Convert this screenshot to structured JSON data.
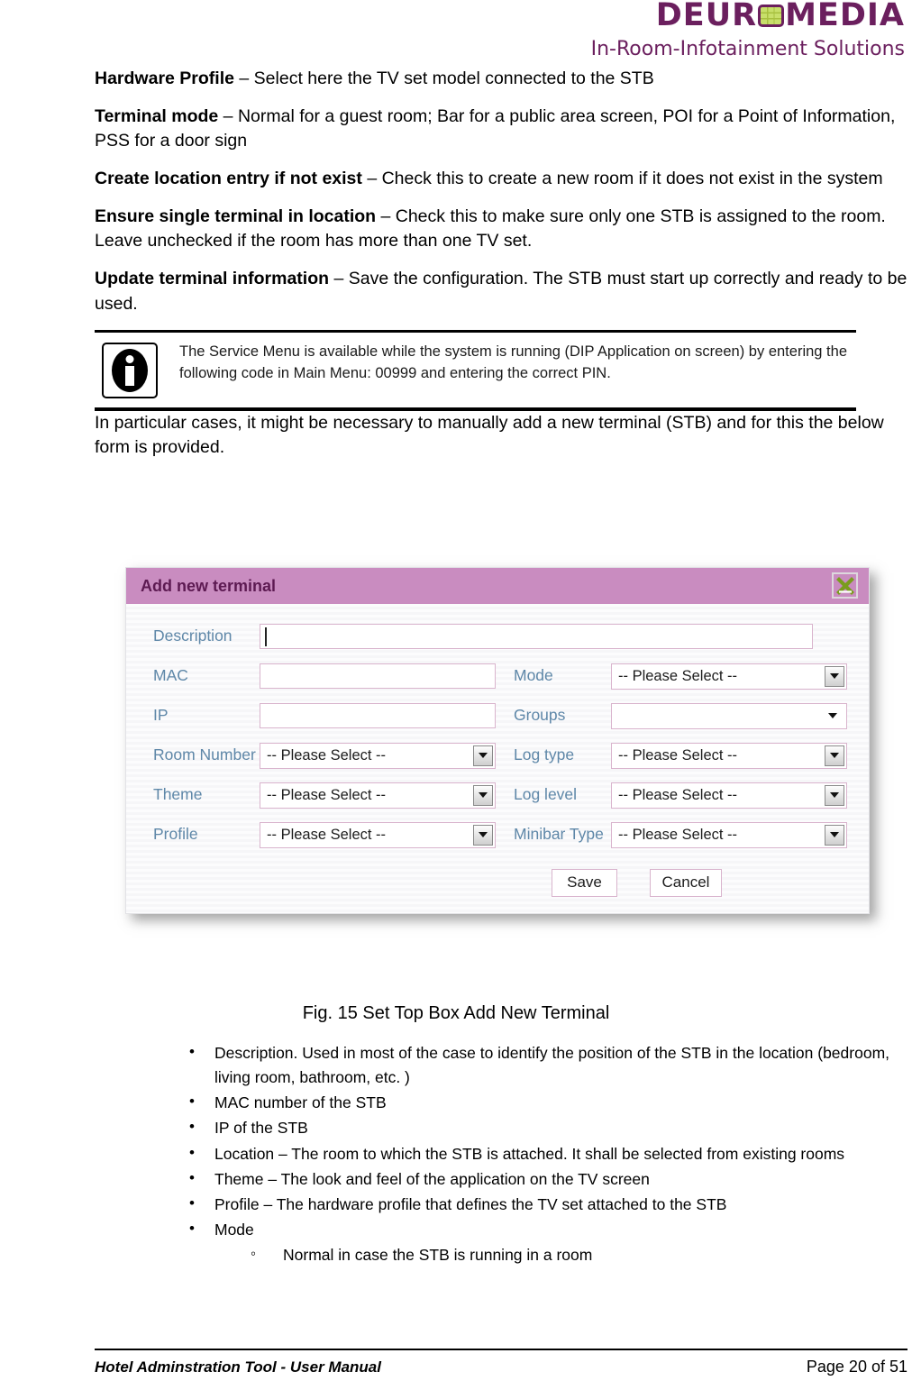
{
  "header": {
    "logo_text_before": "DEUR",
    "logo_icon": "tv-grid-icon",
    "logo_text_after": "MEDIA",
    "logo_tagline": "In-Room-Infotainment Solutions",
    "brand_color": "#6b1f5e",
    "accent_color": "#c8df6a"
  },
  "paragraphs": [
    {
      "term": "Hardware Profile",
      "rest": " – Select here the TV set model connected to the STB"
    },
    {
      "term": "Terminal mode",
      "rest": " – Normal for a guest room; Bar for a public area screen, POI for a Point of Information, PSS for a door sign"
    },
    {
      "term": "Create location entry if not exist",
      "rest": " – Check this to create a new room if it does not exist in the system"
    },
    {
      "term": "Ensure single terminal in location",
      "rest": " – Check this to make sure only one STB is assigned to the room. Leave unchecked if the room has more than one TV set."
    },
    {
      "term": "Update terminal information",
      "rest": " – Save the configuration. The STB must start up correctly and ready to be used."
    }
  ],
  "info_box": {
    "icon": "information-icon",
    "text": "The Service Menu is available while the system is running (DIP Application on screen) by entering the following code in Main Menu: 00999 and entering the correct PIN."
  },
  "intro_paragraph": "In particular cases, it might be necessary to manually add a new terminal (STB) and for this the below form is provided.",
  "dialog": {
    "title": "Add new terminal",
    "close_icon": "close-x-icon",
    "title_bar_color": "#c98cc0",
    "title_text_color": "#5d1a52",
    "field_border_color": "#d9b4cd",
    "label_color": "#5e87a8",
    "close_icon_color": "#7a9c1e",
    "fields": {
      "description": {
        "label": "Description",
        "value": ""
      },
      "mac": {
        "label": "MAC",
        "value": ""
      },
      "ip": {
        "label": "IP",
        "value": ""
      },
      "room_number": {
        "label": "Room Number",
        "value": "-- Please Select --"
      },
      "theme": {
        "label": "Theme",
        "value": "-- Please Select --"
      },
      "profile": {
        "label": "Profile",
        "value": "-- Please Select --"
      },
      "mode": {
        "label": "Mode",
        "value": "-- Please Select --"
      },
      "groups": {
        "label": "Groups",
        "value": ""
      },
      "log_type": {
        "label": "Log type",
        "value": "-- Please Select --"
      },
      "log_level": {
        "label": "Log level",
        "value": "-- Please Select --"
      },
      "minibar_type": {
        "label": "Minibar Type",
        "value": "-- Please Select --"
      }
    },
    "buttons": {
      "save": "Save",
      "cancel": "Cancel"
    }
  },
  "figure_caption": "Fig. 15 Set Top Box Add New Terminal",
  "bullets": [
    "Description. Used in most of the case to identify the position of the STB in the location (bedroom, living room, bathroom, etc. )",
    "MAC number of the STB",
    "IP of the STB",
    "Location – The room to which the STB is attached. It shall be selected from existing rooms",
    "Theme – The look and feel of the application on the TV screen",
    "Profile – The hardware profile that defines the TV set attached to the STB",
    "Mode"
  ],
  "sub_bullets": [
    "Normal in case the STB is running in a room"
  ],
  "footer": {
    "left": "Hotel Adminstration Tool - User Manual",
    "right": "Page 20 of 51"
  }
}
